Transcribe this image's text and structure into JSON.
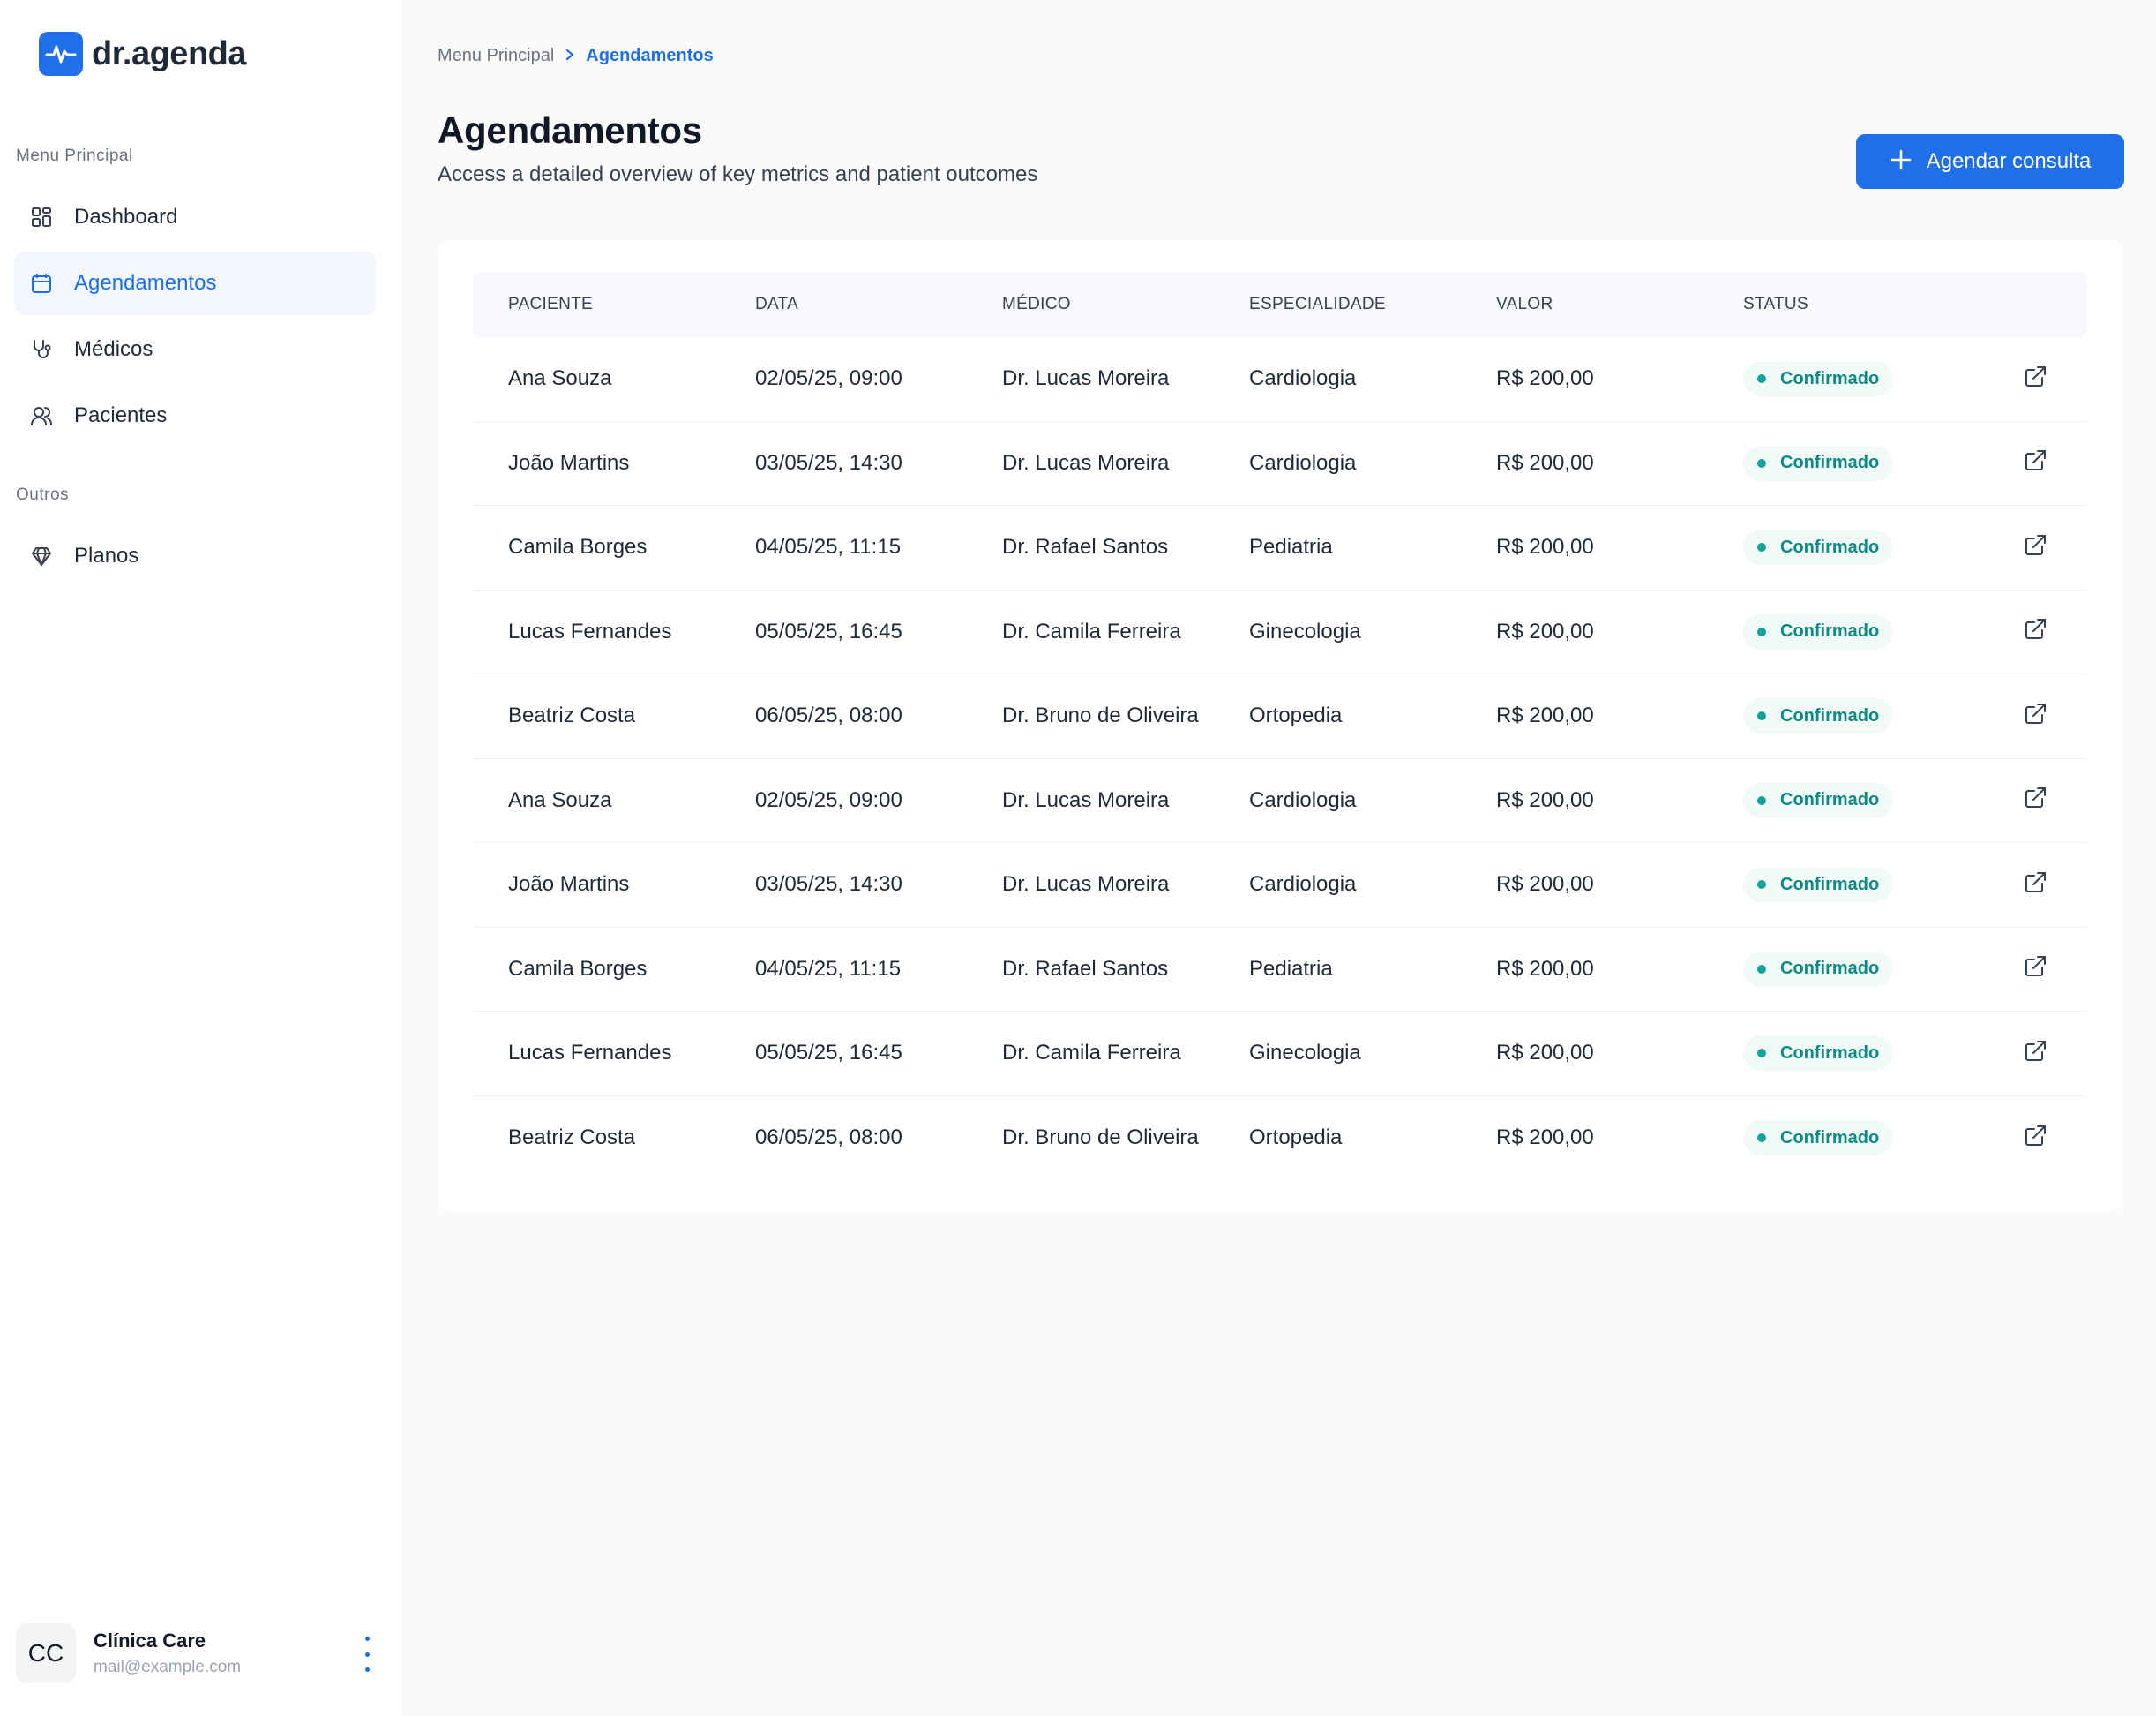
{
  "brand": {
    "name": "dr.agenda"
  },
  "sidebar": {
    "section_main": "Menu Principal",
    "items": [
      {
        "label": "Dashboard",
        "icon": "dashboard-icon"
      },
      {
        "label": "Agendamentos",
        "icon": "calendar-icon",
        "active": true
      },
      {
        "label": "Médicos",
        "icon": "stethoscope-icon"
      },
      {
        "label": "Pacientes",
        "icon": "users-icon"
      }
    ],
    "section_other": "Outros",
    "other_items": [
      {
        "label": "Planos",
        "icon": "diamond-icon"
      }
    ],
    "user": {
      "initials": "CC",
      "name": "Clínica Care",
      "email": "mail@example.com"
    }
  },
  "breadcrumb": {
    "root": "Menu Principal",
    "current": "Agendamentos"
  },
  "header": {
    "title": "Agendamentos",
    "subtitle": "Access a detailed overview of key metrics and patient outcomes",
    "action_label": "Agendar consulta"
  },
  "table": {
    "columns": [
      "PACIENTE",
      "DATA",
      "MÉDICO",
      "ESPECIALIDADE",
      "VALOR",
      "STATUS"
    ],
    "rows": [
      {
        "paciente": "Ana Souza",
        "data": "02/05/25, 09:00",
        "medico": "Dr.  Lucas Moreira",
        "especialidade": "Cardiologia",
        "valor": "R$ 200,00",
        "status": "Confirmado"
      },
      {
        "paciente": "João Martins",
        "data": "03/05/25, 14:30",
        "medico": "Dr.  Lucas Moreira",
        "especialidade": "Cardiologia",
        "valor": "R$ 200,00",
        "status": "Confirmado"
      },
      {
        "paciente": "Camila Borges",
        "data": "04/05/25, 11:15",
        "medico": "Dr. Rafael Santos",
        "especialidade": "Pediatria",
        "valor": "R$ 200,00",
        "status": "Confirmado"
      },
      {
        "paciente": "Lucas Fernandes",
        "data": "05/05/25, 16:45",
        "medico": "Dr. Camila Ferreira",
        "especialidade": "Ginecologia",
        "valor": "R$ 200,00",
        "status": "Confirmado"
      },
      {
        "paciente": "Beatriz Costa",
        "data": "06/05/25, 08:00",
        "medico": "Dr. Bruno de Oliveira",
        "especialidade": "Ortopedia",
        "valor": "R$ 200,00",
        "status": "Confirmado"
      },
      {
        "paciente": "Ana Souza",
        "data": "02/05/25, 09:00",
        "medico": "Dr.  Lucas Moreira",
        "especialidade": "Cardiologia",
        "valor": "R$ 200,00",
        "status": "Confirmado"
      },
      {
        "paciente": "João Martins",
        "data": "03/05/25, 14:30",
        "medico": "Dr.  Lucas Moreira",
        "especialidade": "Cardiologia",
        "valor": "R$ 200,00",
        "status": "Confirmado"
      },
      {
        "paciente": "Camila Borges",
        "data": "04/05/25, 11:15",
        "medico": "Dr. Rafael Santos",
        "especialidade": "Pediatria",
        "valor": "R$ 200,00",
        "status": "Confirmado"
      },
      {
        "paciente": "Lucas Fernandes",
        "data": "05/05/25, 16:45",
        "medico": "Dr. Camila Ferreira",
        "especialidade": "Ginecologia",
        "valor": "R$ 200,00",
        "status": "Confirmado"
      },
      {
        "paciente": "Beatriz Costa",
        "data": "06/05/25, 08:00",
        "medico": "Dr. Bruno de Oliveira",
        "especialidade": "Ortopedia",
        "valor": "R$ 200,00",
        "status": "Confirmado"
      }
    ]
  },
  "colors": {
    "accent": "#1e6fe8",
    "status_confirmed": "#14a39a"
  }
}
